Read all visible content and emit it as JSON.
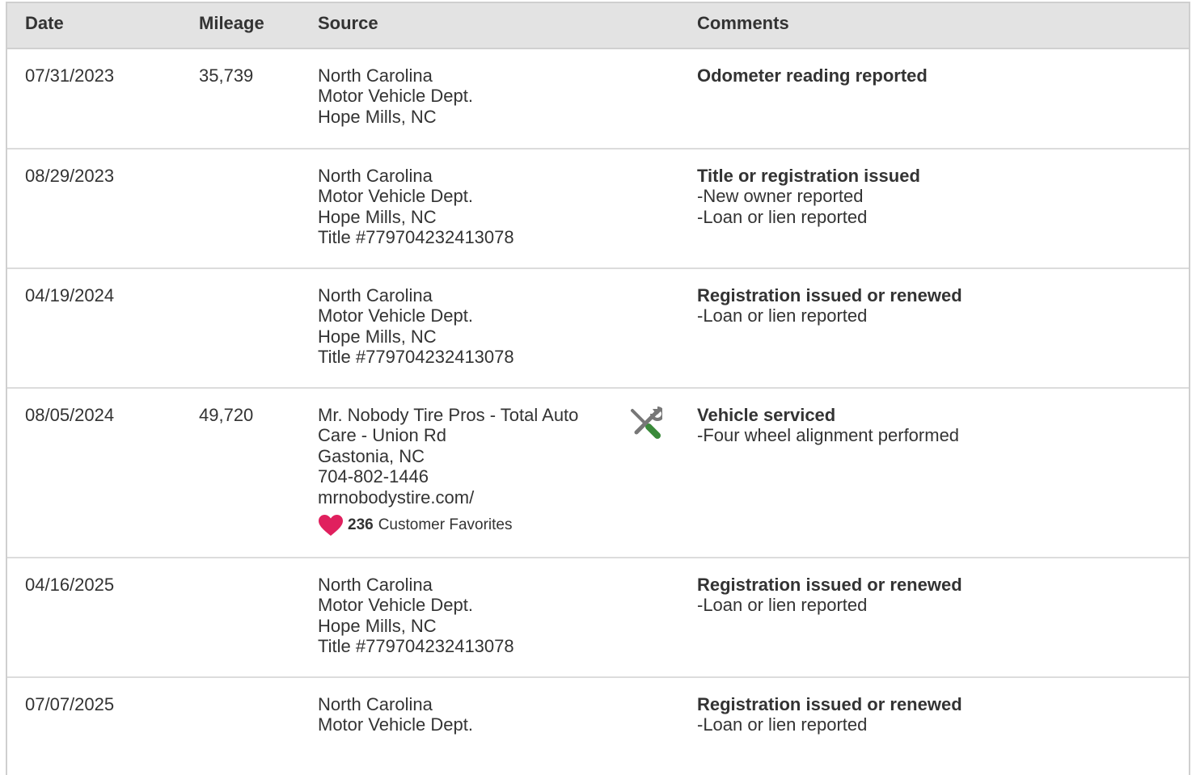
{
  "columns": {
    "date": "Date",
    "mileage": "Mileage",
    "source": "Source",
    "comments": "Comments"
  },
  "rows": [
    {
      "date": "07/31/2023",
      "mileage": "35,739",
      "source": [
        "North Carolina",
        "Motor Vehicle Dept.",
        "Hope Mills, NC"
      ],
      "comment_title": "Odometer reading reported",
      "comment_items": []
    },
    {
      "date": "08/29/2023",
      "mileage": "",
      "source": [
        "North Carolina",
        "Motor Vehicle Dept.",
        "Hope Mills, NC",
        "Title #779704232413078"
      ],
      "comment_title": "Title or registration issued",
      "comment_items": [
        "-New owner reported",
        "-Loan or lien reported"
      ]
    },
    {
      "date": "04/19/2024",
      "mileage": "",
      "source": [
        "North Carolina",
        "Motor Vehicle Dept.",
        "Hope Mills, NC",
        "Title #779704232413078"
      ],
      "comment_title": "Registration issued or renewed",
      "comment_items": [
        "-Loan or lien reported"
      ]
    },
    {
      "date": "08/05/2024",
      "mileage": "49,720",
      "source_name": "Mr. Nobody Tire Pros - Total Auto Care - Union Rd",
      "source": [
        "Gastonia, NC",
        "704-802-1446",
        "mrnobodystire.com/"
      ],
      "favorites_count": "236",
      "favorites_label": "Customer Favorites",
      "service_icon": "wrench-screwdriver-icon",
      "comment_title": "Vehicle serviced",
      "comment_items": [
        "-Four wheel alignment performed"
      ]
    },
    {
      "date": "04/16/2025",
      "mileage": "",
      "source": [
        "North Carolina",
        "Motor Vehicle Dept.",
        "Hope Mills, NC",
        "Title #779704232413078"
      ],
      "comment_title": "Registration issued or renewed",
      "comment_items": [
        "-Loan or lien reported"
      ]
    },
    {
      "date": "07/07/2025",
      "mileage": "",
      "source": [
        "North Carolina",
        "Motor Vehicle Dept."
      ],
      "comment_title": "Registration issued or renewed",
      "comment_items": [
        "-Loan or lien reported"
      ]
    }
  ],
  "colors": {
    "header_bg": "#e3e3e3",
    "text": "#333333",
    "heart": "#e0205e",
    "tool_green": "#3a8a3a",
    "tool_gray": "#777777"
  }
}
